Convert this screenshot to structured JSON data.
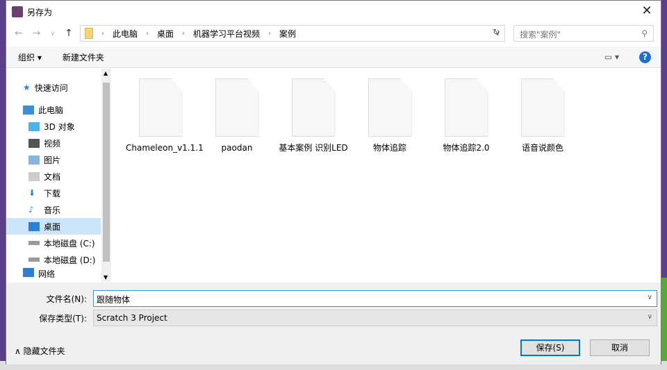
{
  "title": "另存为",
  "address": {
    "crumbs": [
      "此电脑",
      "桌面",
      "机器学习平台视频",
      "案例"
    ],
    "search_placeholder": "搜索\"案例\""
  },
  "toolbar": {
    "organize": "组织 ▾",
    "new_folder": "新建文件夹",
    "help": "?"
  },
  "sidebar": [
    {
      "label": "快速访问",
      "icon": "star-icon"
    },
    {
      "label": "此电脑",
      "icon": "computer-icon"
    },
    {
      "label": "3D 对象",
      "icon": "cube-icon"
    },
    {
      "label": "视频",
      "icon": "video-icon"
    },
    {
      "label": "图片",
      "icon": "picture-icon"
    },
    {
      "label": "文档",
      "icon": "document-icon"
    },
    {
      "label": "下载",
      "icon": "download-icon"
    },
    {
      "label": "音乐",
      "icon": "music-icon"
    },
    {
      "label": "桌面",
      "icon": "desktop-icon",
      "selected": true
    },
    {
      "label": "本地磁盘 (C:)",
      "icon": "drive-icon"
    },
    {
      "label": "本地磁盘 (D:)",
      "icon": "drive-icon"
    },
    {
      "label": "网络",
      "icon": "network-icon"
    }
  ],
  "files": [
    "Chameleon_v1.1.1",
    "paodan",
    "基本案例 识别LED",
    "物体追踪",
    "物体追踪2.0",
    "语音说颜色"
  ],
  "form": {
    "filename_label": "文件名(N):",
    "filename": "跟随物体",
    "type_label": "保存类型(T):",
    "type": "Scratch 3 Project"
  },
  "hide_folders": "∧ 隐藏文件夹",
  "save": "保存(S)",
  "cancel": "取消"
}
